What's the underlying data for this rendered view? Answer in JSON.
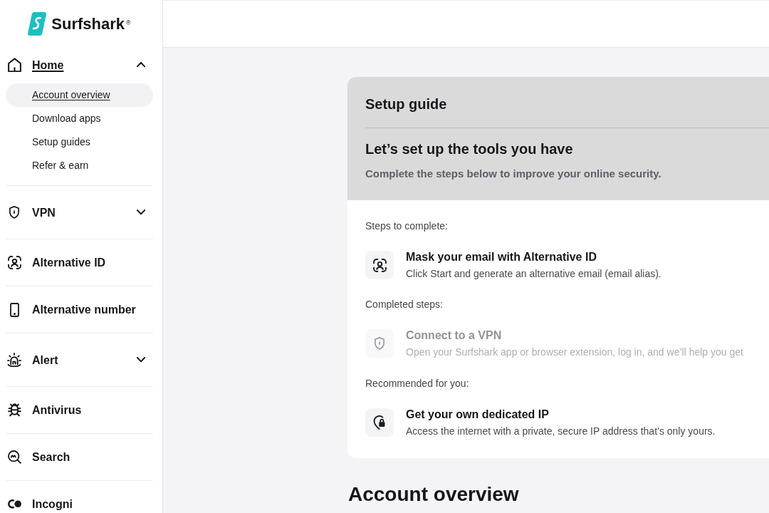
{
  "sidebar": {
    "logo": "Surfshark$^{®}$",
    "items": [
      {
        "label": "Home",
        "kind": "group",
        "selected": true,
        "expanded": true,
        "children": [
          {
            "label": "Account overview",
            "selected": true
          },
          {
            "label": "Download apps",
            "selected": false
          },
          {
            "label": "Setup guides",
            "selected": false
          },
          {
            "label": "Refer & earn",
            "selected": false
          }
        ]
      },
      {
        "label": "VPN",
        "kind": "group",
        "selected": false,
        "expanded": false
      },
      {
        "label": "Alternative ID",
        "kind": "link",
        "selected": false
      },
      {
        "label": "Alternative number",
        "kind": "link",
        "selected": false
      },
      {
        "label": "Alert",
        "kind": "group",
        "selected": false,
        "expanded": false
      },
      {
        "label": "Antivirus",
        "kind": "link",
        "selected": false
      },
      {
        "label": "Search",
        "kind": "link",
        "selected": false
      },
      {
        "label": "Incogni",
        "kind": "link",
        "selected": false
      }
    ]
  },
  "setup_guide": {
    "title": "Setup guide",
    "heading": "Let’s set up the tools you have",
    "subtitle": "Complete the steps below to improve your online security.",
    "sections": [
      {
        "label": "Steps to complete:",
        "steps": [
          {
            "title": "Mask your email with Alternative ID",
            "description": "Click Start and generate an alternative email (email alias).",
            "completed": false
          }
        ]
      },
      {
        "label": "Completed steps:",
        "steps": [
          {
            "title": "Connect to a VPN",
            "description": "Open your Surfshark app or browser extension, log in, and we’ll help you get",
            "completed": true
          }
        ]
      },
      {
        "label": "Recommended for you:",
        "steps": [
          {
            "title": "Get your own dedicated IP",
            "description": "Access the internet with a private, secure IP address that’s only yours.",
            "completed": false
          }
        ]
      }
    ]
  },
  "page_heading": "Account overview"
}
